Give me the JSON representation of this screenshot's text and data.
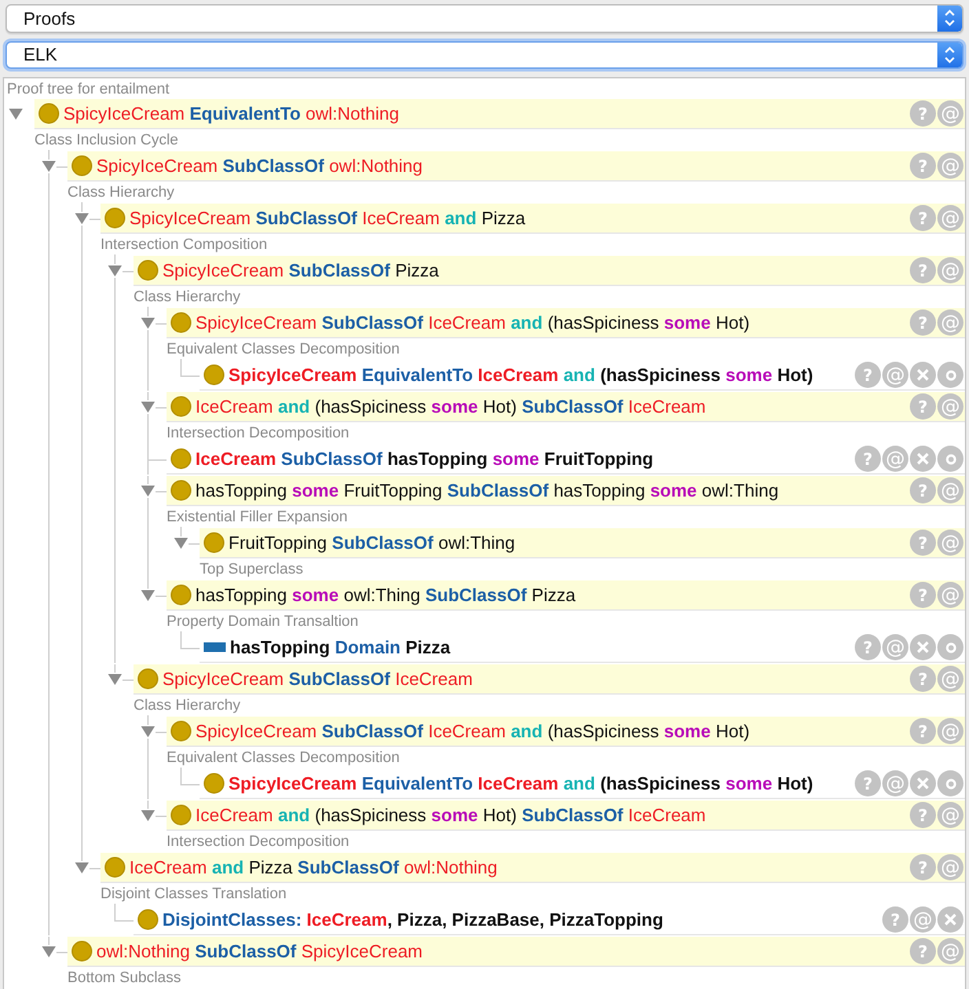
{
  "selects": [
    {
      "value": "Proofs",
      "focused": false
    },
    {
      "value": "ELK",
      "focused": true
    }
  ],
  "panel": {
    "title": "Proof tree for entailment"
  },
  "tree": {
    "kind": "class",
    "asserted": false,
    "expanded": true,
    "rule": "Class Inclusion Cycle",
    "buttons": [
      {
        "kind": "help",
        "label": "?"
      },
      {
        "kind": "annotate",
        "label": "@"
      }
    ],
    "axiom": [
      {
        "kind": "class",
        "text": "SpicyIceCream"
      },
      {
        "kind": "keyword",
        "text": "EquivalentTo"
      },
      {
        "kind": "class",
        "text": "owl:Nothing"
      }
    ],
    "children": [
      {
        "kind": "class",
        "asserted": false,
        "expanded": true,
        "rule": "Class Hierarchy",
        "buttons": [
          {
            "kind": "help",
            "label": "?"
          },
          {
            "kind": "annotate",
            "label": "@"
          }
        ],
        "axiom": [
          {
            "kind": "class",
            "text": "SpicyIceCream"
          },
          {
            "kind": "keyword",
            "text": "SubClassOf"
          },
          {
            "kind": "class",
            "text": "owl:Nothing"
          }
        ],
        "children": [
          {
            "kind": "class",
            "asserted": false,
            "expanded": true,
            "rule": "Intersection Composition",
            "buttons": [
              {
                "kind": "help",
                "label": "?"
              },
              {
                "kind": "annotate",
                "label": "@"
              }
            ],
            "axiom": [
              {
                "kind": "class",
                "text": "SpicyIceCream"
              },
              {
                "kind": "keyword",
                "text": "SubClassOf"
              },
              {
                "kind": "class",
                "text": "IceCream"
              },
              {
                "kind": "operator",
                "text": "and"
              },
              {
                "kind": "plain",
                "text": "Pizza"
              }
            ],
            "children": [
              {
                "kind": "class",
                "asserted": false,
                "expanded": true,
                "rule": "Class Hierarchy",
                "buttons": [
                  {
                    "kind": "help",
                    "label": "?"
                  },
                  {
                    "kind": "annotate",
                    "label": "@"
                  }
                ],
                "axiom": [
                  {
                    "kind": "class",
                    "text": "SpicyIceCream"
                  },
                  {
                    "kind": "keyword",
                    "text": "SubClassOf"
                  },
                  {
                    "kind": "plain",
                    "text": "Pizza"
                  }
                ],
                "children": [
                  {
                    "kind": "class",
                    "asserted": false,
                    "expanded": true,
                    "rule": "Equivalent Classes Decomposition",
                    "buttons": [
                      {
                        "kind": "help",
                        "label": "?"
                      },
                      {
                        "kind": "annotate",
                        "label": "@"
                      }
                    ],
                    "axiom": [
                      {
                        "kind": "class",
                        "text": "SpicyIceCream"
                      },
                      {
                        "kind": "keyword",
                        "text": "SubClassOf"
                      },
                      {
                        "kind": "class",
                        "text": "IceCream"
                      },
                      {
                        "kind": "operator",
                        "text": "and"
                      },
                      {
                        "kind": "plain",
                        "text": "(hasSpiciness"
                      },
                      {
                        "kind": "quantifier",
                        "text": "some"
                      },
                      {
                        "kind": "plain",
                        "text": "Hot)"
                      }
                    ],
                    "children": [
                      {
                        "kind": "class",
                        "asserted": true,
                        "buttons": [
                          {
                            "kind": "help",
                            "label": "?"
                          },
                          {
                            "kind": "annotate",
                            "label": "@"
                          },
                          {
                            "kind": "delete"
                          },
                          {
                            "kind": "edit"
                          }
                        ],
                        "axiom": [
                          {
                            "kind": "class",
                            "text": "SpicyIceCream"
                          },
                          {
                            "kind": "keyword",
                            "text": "EquivalentTo"
                          },
                          {
                            "kind": "class",
                            "text": "IceCream"
                          },
                          {
                            "kind": "operator",
                            "text": "and"
                          },
                          {
                            "kind": "plain",
                            "text": "(hasSpiciness"
                          },
                          {
                            "kind": "quantifier",
                            "text": "some"
                          },
                          {
                            "kind": "plain",
                            "text": "Hot)"
                          }
                        ]
                      }
                    ]
                  },
                  {
                    "kind": "class",
                    "asserted": false,
                    "expanded": true,
                    "rule": "Intersection Decomposition",
                    "buttons": [
                      {
                        "kind": "help",
                        "label": "?"
                      },
                      {
                        "kind": "annotate",
                        "label": "@"
                      }
                    ],
                    "axiom": [
                      {
                        "kind": "class",
                        "text": "IceCream"
                      },
                      {
                        "kind": "operator",
                        "text": "and"
                      },
                      {
                        "kind": "plain",
                        "text": "(hasSpiciness"
                      },
                      {
                        "kind": "quantifier",
                        "text": "some"
                      },
                      {
                        "kind": "plain",
                        "text": "Hot)"
                      },
                      {
                        "kind": "keyword",
                        "text": "SubClassOf"
                      },
                      {
                        "kind": "class",
                        "text": "IceCream"
                      }
                    ]
                  },
                  {
                    "kind": "class",
                    "asserted": true,
                    "buttons": [
                      {
                        "kind": "help",
                        "label": "?"
                      },
                      {
                        "kind": "annotate",
                        "label": "@"
                      },
                      {
                        "kind": "delete"
                      },
                      {
                        "kind": "edit"
                      }
                    ],
                    "axiom": [
                      {
                        "kind": "class",
                        "text": "IceCream"
                      },
                      {
                        "kind": "keyword",
                        "text": "SubClassOf"
                      },
                      {
                        "kind": "plain",
                        "text": "hasTopping"
                      },
                      {
                        "kind": "quantifier",
                        "text": "some"
                      },
                      {
                        "kind": "plain",
                        "text": "FruitTopping"
                      }
                    ]
                  },
                  {
                    "kind": "class",
                    "asserted": false,
                    "expanded": true,
                    "rule": "Existential Filler Expansion",
                    "buttons": [
                      {
                        "kind": "help",
                        "label": "?"
                      },
                      {
                        "kind": "annotate",
                        "label": "@"
                      }
                    ],
                    "axiom": [
                      {
                        "kind": "plain",
                        "text": "hasTopping"
                      },
                      {
                        "kind": "quantifier",
                        "text": "some"
                      },
                      {
                        "kind": "plain",
                        "text": "FruitTopping"
                      },
                      {
                        "kind": "keyword",
                        "text": "SubClassOf"
                      },
                      {
                        "kind": "plain",
                        "text": "hasTopping"
                      },
                      {
                        "kind": "quantifier",
                        "text": "some"
                      },
                      {
                        "kind": "plain",
                        "text": "owl:Thing"
                      }
                    ],
                    "children": [
                      {
                        "kind": "class",
                        "asserted": false,
                        "expanded": true,
                        "rule": "Top Superclass",
                        "buttons": [
                          {
                            "kind": "help",
                            "label": "?"
                          },
                          {
                            "kind": "annotate",
                            "label": "@"
                          }
                        ],
                        "axiom": [
                          {
                            "kind": "plain",
                            "text": "FruitTopping"
                          },
                          {
                            "kind": "keyword",
                            "text": "SubClassOf"
                          },
                          {
                            "kind": "plain",
                            "text": "owl:Thing"
                          }
                        ]
                      }
                    ]
                  },
                  {
                    "kind": "class",
                    "asserted": false,
                    "expanded": true,
                    "rule": "Property Domain Transaltion",
                    "buttons": [
                      {
                        "kind": "help",
                        "label": "?"
                      },
                      {
                        "kind": "annotate",
                        "label": "@"
                      }
                    ],
                    "axiom": [
                      {
                        "kind": "plain",
                        "text": "hasTopping"
                      },
                      {
                        "kind": "quantifier",
                        "text": "some"
                      },
                      {
                        "kind": "plain",
                        "text": "owl:Thing"
                      },
                      {
                        "kind": "keyword",
                        "text": "SubClassOf"
                      },
                      {
                        "kind": "plain",
                        "text": "Pizza"
                      }
                    ],
                    "children": [
                      {
                        "kind": "property",
                        "asserted": true,
                        "buttons": [
                          {
                            "kind": "help",
                            "label": "?"
                          },
                          {
                            "kind": "annotate",
                            "label": "@"
                          },
                          {
                            "kind": "delete"
                          },
                          {
                            "kind": "edit"
                          }
                        ],
                        "axiom": [
                          {
                            "kind": "plain",
                            "text": "hasTopping"
                          },
                          {
                            "kind": "keyword",
                            "text": "Domain"
                          },
                          {
                            "kind": "plain",
                            "text": "Pizza"
                          }
                        ]
                      }
                    ]
                  }
                ]
              },
              {
                "kind": "class",
                "asserted": false,
                "expanded": true,
                "rule": "Class Hierarchy",
                "buttons": [
                  {
                    "kind": "help",
                    "label": "?"
                  },
                  {
                    "kind": "annotate",
                    "label": "@"
                  }
                ],
                "axiom": [
                  {
                    "kind": "class",
                    "text": "SpicyIceCream"
                  },
                  {
                    "kind": "keyword",
                    "text": "SubClassOf"
                  },
                  {
                    "kind": "class",
                    "text": "IceCream"
                  }
                ],
                "children": [
                  {
                    "kind": "class",
                    "asserted": false,
                    "expanded": true,
                    "rule": "Equivalent Classes Decomposition",
                    "buttons": [
                      {
                        "kind": "help",
                        "label": "?"
                      },
                      {
                        "kind": "annotate",
                        "label": "@"
                      }
                    ],
                    "axiom": [
                      {
                        "kind": "class",
                        "text": "SpicyIceCream"
                      },
                      {
                        "kind": "keyword",
                        "text": "SubClassOf"
                      },
                      {
                        "kind": "class",
                        "text": "IceCream"
                      },
                      {
                        "kind": "operator",
                        "text": "and"
                      },
                      {
                        "kind": "plain",
                        "text": "(hasSpiciness"
                      },
                      {
                        "kind": "quantifier",
                        "text": "some"
                      },
                      {
                        "kind": "plain",
                        "text": "Hot)"
                      }
                    ],
                    "children": [
                      {
                        "kind": "class",
                        "asserted": true,
                        "buttons": [
                          {
                            "kind": "help",
                            "label": "?"
                          },
                          {
                            "kind": "annotate",
                            "label": "@"
                          },
                          {
                            "kind": "delete"
                          },
                          {
                            "kind": "edit"
                          }
                        ],
                        "axiom": [
                          {
                            "kind": "class",
                            "text": "SpicyIceCream"
                          },
                          {
                            "kind": "keyword",
                            "text": "EquivalentTo"
                          },
                          {
                            "kind": "class",
                            "text": "IceCream"
                          },
                          {
                            "kind": "operator",
                            "text": "and"
                          },
                          {
                            "kind": "plain",
                            "text": "(hasSpiciness"
                          },
                          {
                            "kind": "quantifier",
                            "text": "some"
                          },
                          {
                            "kind": "plain",
                            "text": "Hot)"
                          }
                        ]
                      }
                    ]
                  },
                  {
                    "kind": "class",
                    "asserted": false,
                    "expanded": true,
                    "rule": "Intersection Decomposition",
                    "buttons": [
                      {
                        "kind": "help",
                        "label": "?"
                      },
                      {
                        "kind": "annotate",
                        "label": "@"
                      }
                    ],
                    "axiom": [
                      {
                        "kind": "class",
                        "text": "IceCream"
                      },
                      {
                        "kind": "operator",
                        "text": "and"
                      },
                      {
                        "kind": "plain",
                        "text": "(hasSpiciness"
                      },
                      {
                        "kind": "quantifier",
                        "text": "some"
                      },
                      {
                        "kind": "plain",
                        "text": "Hot)"
                      },
                      {
                        "kind": "keyword",
                        "text": "SubClassOf"
                      },
                      {
                        "kind": "class",
                        "text": "IceCream"
                      }
                    ]
                  }
                ]
              }
            ]
          },
          {
            "kind": "class",
            "asserted": false,
            "expanded": true,
            "rule": "Disjoint Classes Translation",
            "buttons": [
              {
                "kind": "help",
                "label": "?"
              },
              {
                "kind": "annotate",
                "label": "@"
              }
            ],
            "axiom": [
              {
                "kind": "class",
                "text": "IceCream"
              },
              {
                "kind": "operator",
                "text": "and"
              },
              {
                "kind": "plain",
                "text": "Pizza"
              },
              {
                "kind": "keyword",
                "text": "SubClassOf"
              },
              {
                "kind": "class",
                "text": "owl:Nothing"
              }
            ],
            "children": [
              {
                "kind": "class",
                "asserted": true,
                "buttons": [
                  {
                    "kind": "help",
                    "label": "?"
                  },
                  {
                    "kind": "annotate",
                    "label": "@"
                  },
                  {
                    "kind": "delete"
                  }
                ],
                "axiom": [
                  {
                    "kind": "keyword",
                    "text": "DisjointClasses:"
                  },
                  {
                    "kind": "class",
                    "text": "IceCream"
                  },
                  {
                    "kind": "plain",
                    "text": ", Pizza, PizzaBase, PizzaTopping",
                    "glue": true
                  }
                ]
              }
            ]
          }
        ]
      },
      {
        "kind": "class",
        "asserted": false,
        "expanded": true,
        "rule": "Bottom Subclass",
        "buttons": [
          {
            "kind": "help",
            "label": "?"
          },
          {
            "kind": "annotate",
            "label": "@"
          }
        ],
        "axiom": [
          {
            "kind": "class",
            "text": "owl:Nothing"
          },
          {
            "kind": "keyword",
            "text": "SubClassOf"
          },
          {
            "kind": "class",
            "text": "SpicyIceCream"
          }
        ]
      }
    ]
  }
}
